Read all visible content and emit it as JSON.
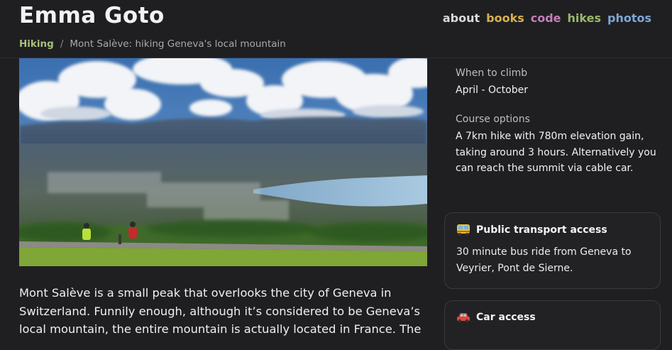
{
  "site": {
    "title": "Emma Goto"
  },
  "nav": [
    {
      "label": "about",
      "color": "#d9d9dd"
    },
    {
      "label": "books",
      "color": "#d9b04e"
    },
    {
      "label": "code",
      "color": "#c67fb6"
    },
    {
      "label": "hikes",
      "color": "#9bb86a"
    },
    {
      "label": "photos",
      "color": "#7fa7d4"
    }
  ],
  "breadcrumb": {
    "root": "Hiking",
    "root_color": "#a8c07a",
    "separator": "/",
    "current": "Mont Salève: hiking Geneva's local mountain"
  },
  "hero": {
    "alt": "Hikers overlooking Geneva and the lake from Mont Salève"
  },
  "sidebar": {
    "when": {
      "label": "When to climb",
      "value": "April - October"
    },
    "course": {
      "label": "Course options",
      "value": "A 7km hike with 780m elevation gain, taking around 3 hours. Alternatively you can reach the summit via cable car."
    },
    "transport": {
      "icon": "bus-icon",
      "title": "Public transport access",
      "body": "30 minute bus ride from Geneva to Veyrier, Pont de Sierne."
    },
    "car": {
      "icon": "car-icon",
      "title": "Car access"
    }
  },
  "intro": "Mont Salève is a small peak that overlooks the city of Geneva in Switzerland. Funnily enough, although it’s considered to be Geneva’s local mountain, the entire mountain is actually located in France. The"
}
